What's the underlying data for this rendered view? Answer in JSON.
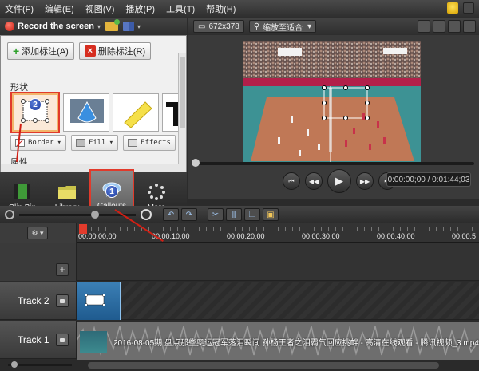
{
  "menubar": {
    "items": [
      "文件(F)",
      "编辑(E)",
      "视图(V)",
      "播放(P)",
      "工具(T)",
      "帮助(H)"
    ]
  },
  "record_bar": {
    "label": "Record the screen",
    "chevron": "▾"
  },
  "annotation_buttons": {
    "add": "添加标注(A)",
    "delete": "删除标注(R)"
  },
  "properties": {
    "shape_heading": "形状",
    "attributes_heading": "属性",
    "border_label": "Border",
    "fill_label": "Fill",
    "effects_label": "Effects"
  },
  "tools": [
    {
      "label": "Clip Bin",
      "icon": "film-strip-icon"
    },
    {
      "label": "Library",
      "icon": "folder-icon"
    },
    {
      "label": "Callouts",
      "icon": "speech-bubble-icon",
      "active": true
    },
    {
      "label": "More",
      "icon": "more-dots-icon"
    }
  ],
  "preview_bar": {
    "resolution": "672x378",
    "zoom_mode": "缩放至适合"
  },
  "transport": {
    "timecode": "0:00:00;00 / 0:01:44;03"
  },
  "timeline": {
    "ruler_labels": [
      "00:00:00;00",
      "00:00:10;00",
      "00:00:20;00",
      "00:00:30;00",
      "00:00:40;00",
      "00:00:5"
    ],
    "tracks": [
      {
        "name": "Track 2"
      },
      {
        "name": "Track 1"
      }
    ],
    "media_clip_title": "2016-08-05期 盘点那些奥运冠军落泪瞬间 孙杨王者之泪霸气回应挑衅 - 高清在线观看 - 腾讯视频_3.mp4"
  },
  "annotations": {
    "badge_1": "1",
    "badge_2": "2"
  },
  "colors": {
    "accent_red": "#e13a2b",
    "badge_blue": "#1c3a9e"
  }
}
